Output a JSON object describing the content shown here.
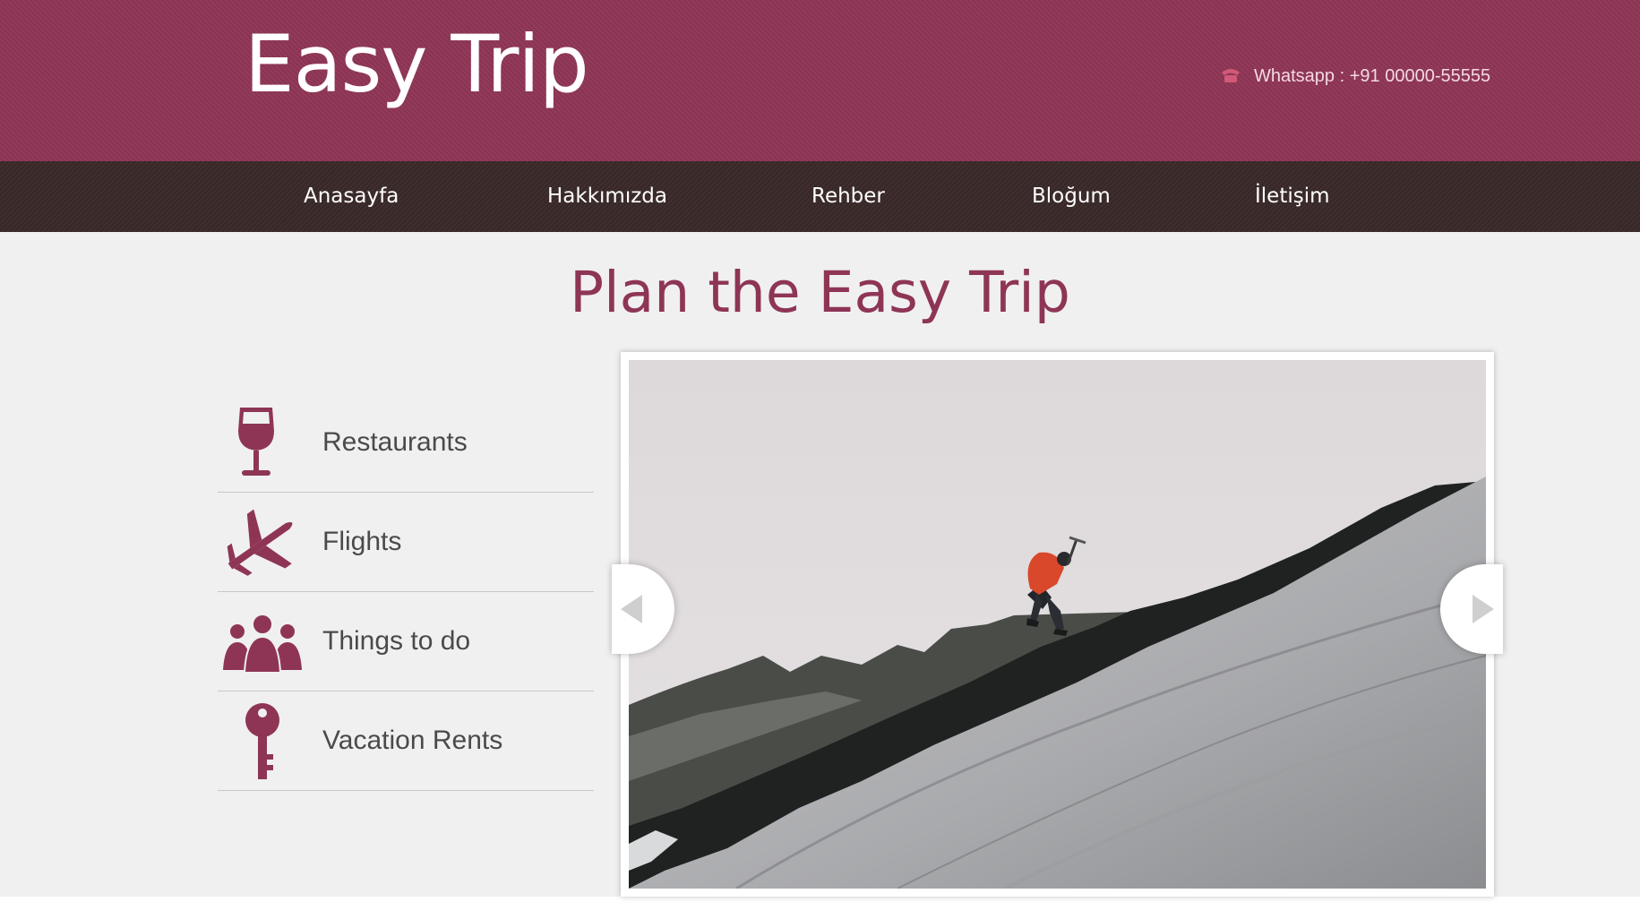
{
  "header": {
    "logo": "Easy Trip",
    "contact": "Whatsapp : +91 00000-55555",
    "contact_icon": "phone-icon"
  },
  "nav": {
    "items": [
      "Anasayfa",
      "Hakkımızda",
      "Rehber",
      "Bloğum",
      "İletişim"
    ]
  },
  "main": {
    "title": "Plan the Easy Trip",
    "categories": [
      {
        "label": "Restaurants",
        "icon": "wine-glass-icon"
      },
      {
        "label": "Flights",
        "icon": "airplane-icon"
      },
      {
        "label": "Things to do",
        "icon": "people-icon"
      },
      {
        "label": "Vacation Rents",
        "icon": "key-icon"
      }
    ],
    "slider": {
      "image": "mountain-climber-image",
      "prev_icon": "chevron-left-icon",
      "next_icon": "chevron-right-icon"
    }
  },
  "colors": {
    "brand": "#8e3556",
    "nav_bg": "#3a2a29",
    "content_bg": "#f0f0f0"
  }
}
